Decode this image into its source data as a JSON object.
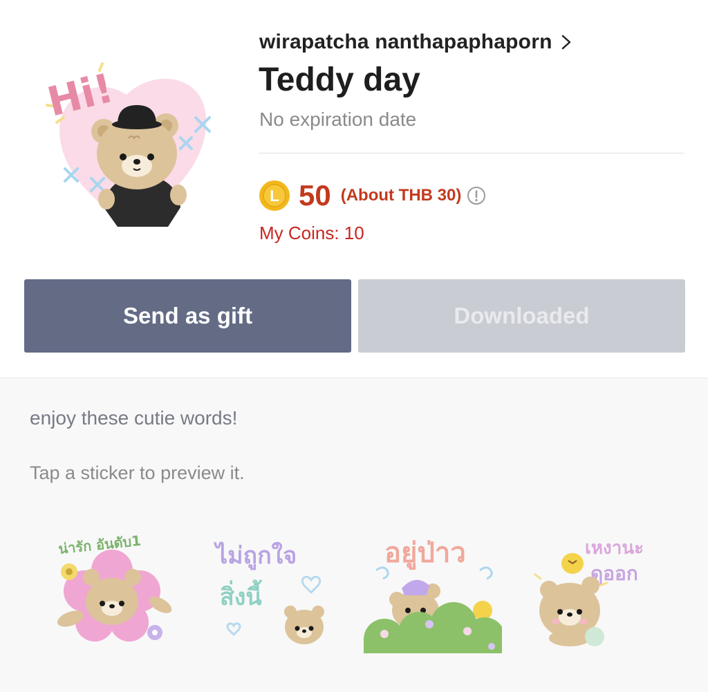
{
  "pack": {
    "author": "wirapatcha nanthapaphaporn",
    "title": "Teddy day",
    "expiry": "No expiration date",
    "hi_text": "Hi!"
  },
  "price": {
    "coin_symbol": "L",
    "amount": "50",
    "approx": "(About THB 30)",
    "info_icon": "info-icon",
    "my_coins": "My Coins: 10"
  },
  "actions": {
    "gift_label": "Send as gift",
    "downloaded_label": "Downloaded"
  },
  "details": {
    "description": "enjoy these cutie words!",
    "hint": "Tap a sticker to preview it."
  },
  "stickers": [
    {
      "text_line1": "น่ารัก อันดับ1",
      "text_line2": ""
    },
    {
      "text_line1": "ไม่ถูกใจ",
      "text_line2": "สิ่งนี้"
    },
    {
      "text_line1": "อยู่ป่าว",
      "text_line2": ""
    },
    {
      "text_line1": "เหงานะ",
      "text_line2": "ดูออก"
    }
  ],
  "colors": {
    "accent_red": "#c23a1e",
    "gift_button": "#636b85",
    "downloaded_button": "#c9ccd3",
    "coin_gold": "#f2b81c"
  }
}
